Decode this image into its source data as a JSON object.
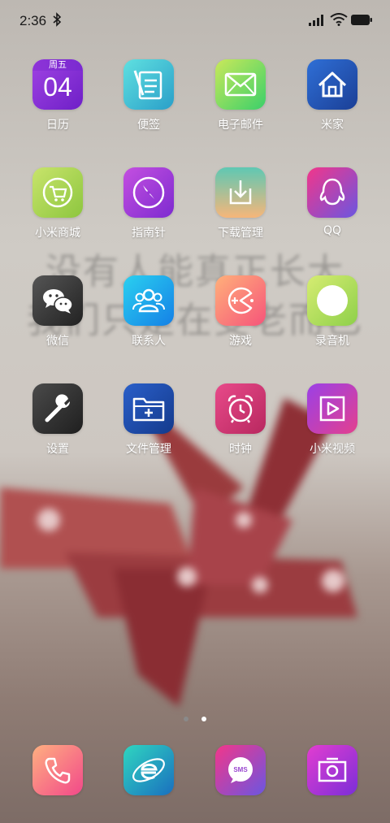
{
  "status_bar": {
    "time": "2:36"
  },
  "calendar": {
    "weekday": "周五",
    "day": "04"
  },
  "apps": [
    {
      "label": "日历"
    },
    {
      "label": "便签"
    },
    {
      "label": "电子邮件"
    },
    {
      "label": "米家"
    },
    {
      "label": "小米商城"
    },
    {
      "label": "指南针"
    },
    {
      "label": "下载管理"
    },
    {
      "label": "QQ"
    },
    {
      "label": "微信"
    },
    {
      "label": "联系人"
    },
    {
      "label": "游戏"
    },
    {
      "label": "录音机"
    },
    {
      "label": "设置"
    },
    {
      "label": "文件管理"
    },
    {
      "label": "时钟"
    },
    {
      "label": "小米视频"
    }
  ],
  "wallpaper_text": [
    "没有人能真正长大",
    "我们只是在变老而已"
  ],
  "dock_icons": [
    "phone-icon",
    "browser-icon",
    "sms-icon",
    "camera-icon"
  ],
  "sms_text": "SMS",
  "page_indicator": {
    "pages": 2,
    "current": 2
  },
  "colors": {
    "label": "#ffffff",
    "dot_active": "#ffffff",
    "dot_inactive": "#8a8a8a"
  }
}
